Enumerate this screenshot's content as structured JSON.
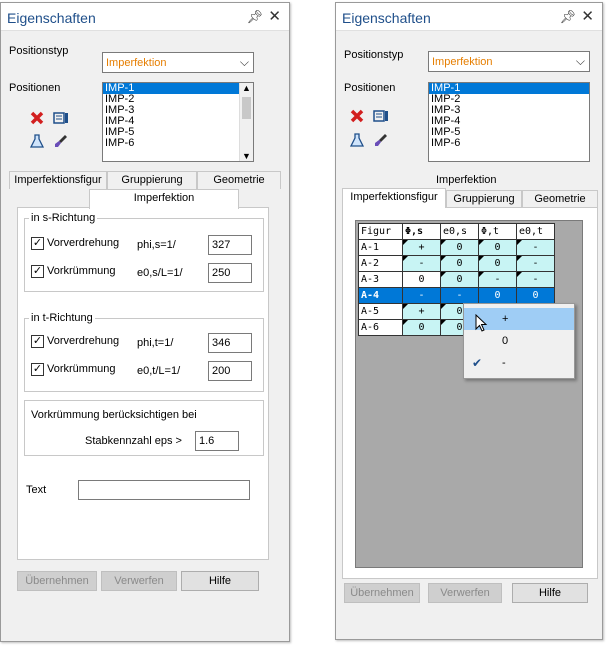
{
  "colors": {
    "title": "#1f4f8a",
    "accent_orange": "#e67e00",
    "selection": "#0078d7",
    "cell": "#c8f4f4",
    "menu_highlight": "#9fcdf5"
  },
  "left": {
    "title": "Eigenschaften",
    "pin_icon": "pin-icon",
    "close_icon": "close-icon",
    "positionstyp_label": "Positionstyp",
    "positionstyp_value": "Imperfektion",
    "positionen_label": "Positionen",
    "positions": [
      "IMP-1",
      "IMP-2",
      "IMP-3",
      "IMP-4",
      "IMP-5",
      "IMP-6"
    ],
    "tabs": [
      "Imperfektionsfigur",
      "Gruppierung",
      "Geometrie"
    ],
    "active_tab": "Imperfektion",
    "s_group": {
      "title": "in s-Richtung",
      "vorverdrehung_label": "Vorverdrehung",
      "vorverdrehung_checked": true,
      "phi_label": "phi,s=1/",
      "phi_value": "327",
      "vorkruemmung_label": "Vorkrümmung",
      "vorkruemmung_checked": true,
      "e0_label": "e0,s/L=1/",
      "e0_value": "250"
    },
    "t_group": {
      "title": "in t-Richtung",
      "vorverdrehung_label": "Vorverdrehung",
      "vorverdrehung_checked": true,
      "phi_label": "phi,t=1/",
      "phi_value": "346",
      "vorkruemmung_label": "Vorkrümmung",
      "vorkruemmung_checked": true,
      "e0_label": "e0,t/L=1/",
      "e0_value": "200"
    },
    "vk_group": {
      "title": "Vorkrümmung berücksichtigen bei",
      "eps_label": "Stabkennzahl eps >",
      "eps_value": "1.6"
    },
    "text_label": "Text",
    "text_value": "",
    "buttons": {
      "apply": "Übernehmen",
      "discard": "Verwerfen",
      "help": "Hilfe"
    }
  },
  "right": {
    "title": "Eigenschaften",
    "positionstyp_label": "Positionstyp",
    "positionstyp_value": "Imperfektion",
    "positionen_label": "Positionen",
    "positions": [
      "IMP-1",
      "IMP-2",
      "IMP-3",
      "IMP-4",
      "IMP-5",
      "IMP-6"
    ],
    "page_title": "Imperfektion",
    "tabs": [
      "Imperfektionsfigur",
      "Gruppierung",
      "Geometrie"
    ],
    "grid": {
      "headers": [
        "Figur",
        "Φ,s",
        "e0,s",
        "Φ,t",
        "e0,t"
      ],
      "rows": [
        {
          "name": "A-1",
          "cells": [
            "+",
            "0",
            "0",
            "-"
          ]
        },
        {
          "name": "A-2",
          "cells": [
            "-",
            "0",
            "0",
            "-"
          ]
        },
        {
          "name": "A-3",
          "cells": [
            "0",
            "0",
            "-",
            "-"
          ]
        },
        {
          "name": "A-4",
          "cells": [
            "-",
            "-",
            "0",
            "0"
          ]
        },
        {
          "name": "A-5",
          "cells": [
            "+",
            "0",
            "",
            ""
          ]
        },
        {
          "name": "A-6",
          "cells": [
            "0",
            "0",
            "",
            ""
          ]
        }
      ]
    },
    "context_menu": {
      "items": [
        "+",
        "0",
        "-"
      ],
      "checked_index": 2,
      "highlighted_index": 0
    },
    "buttons": {
      "apply": "Übernehmen",
      "discard": "Verwerfen",
      "help": "Hilfe"
    }
  }
}
